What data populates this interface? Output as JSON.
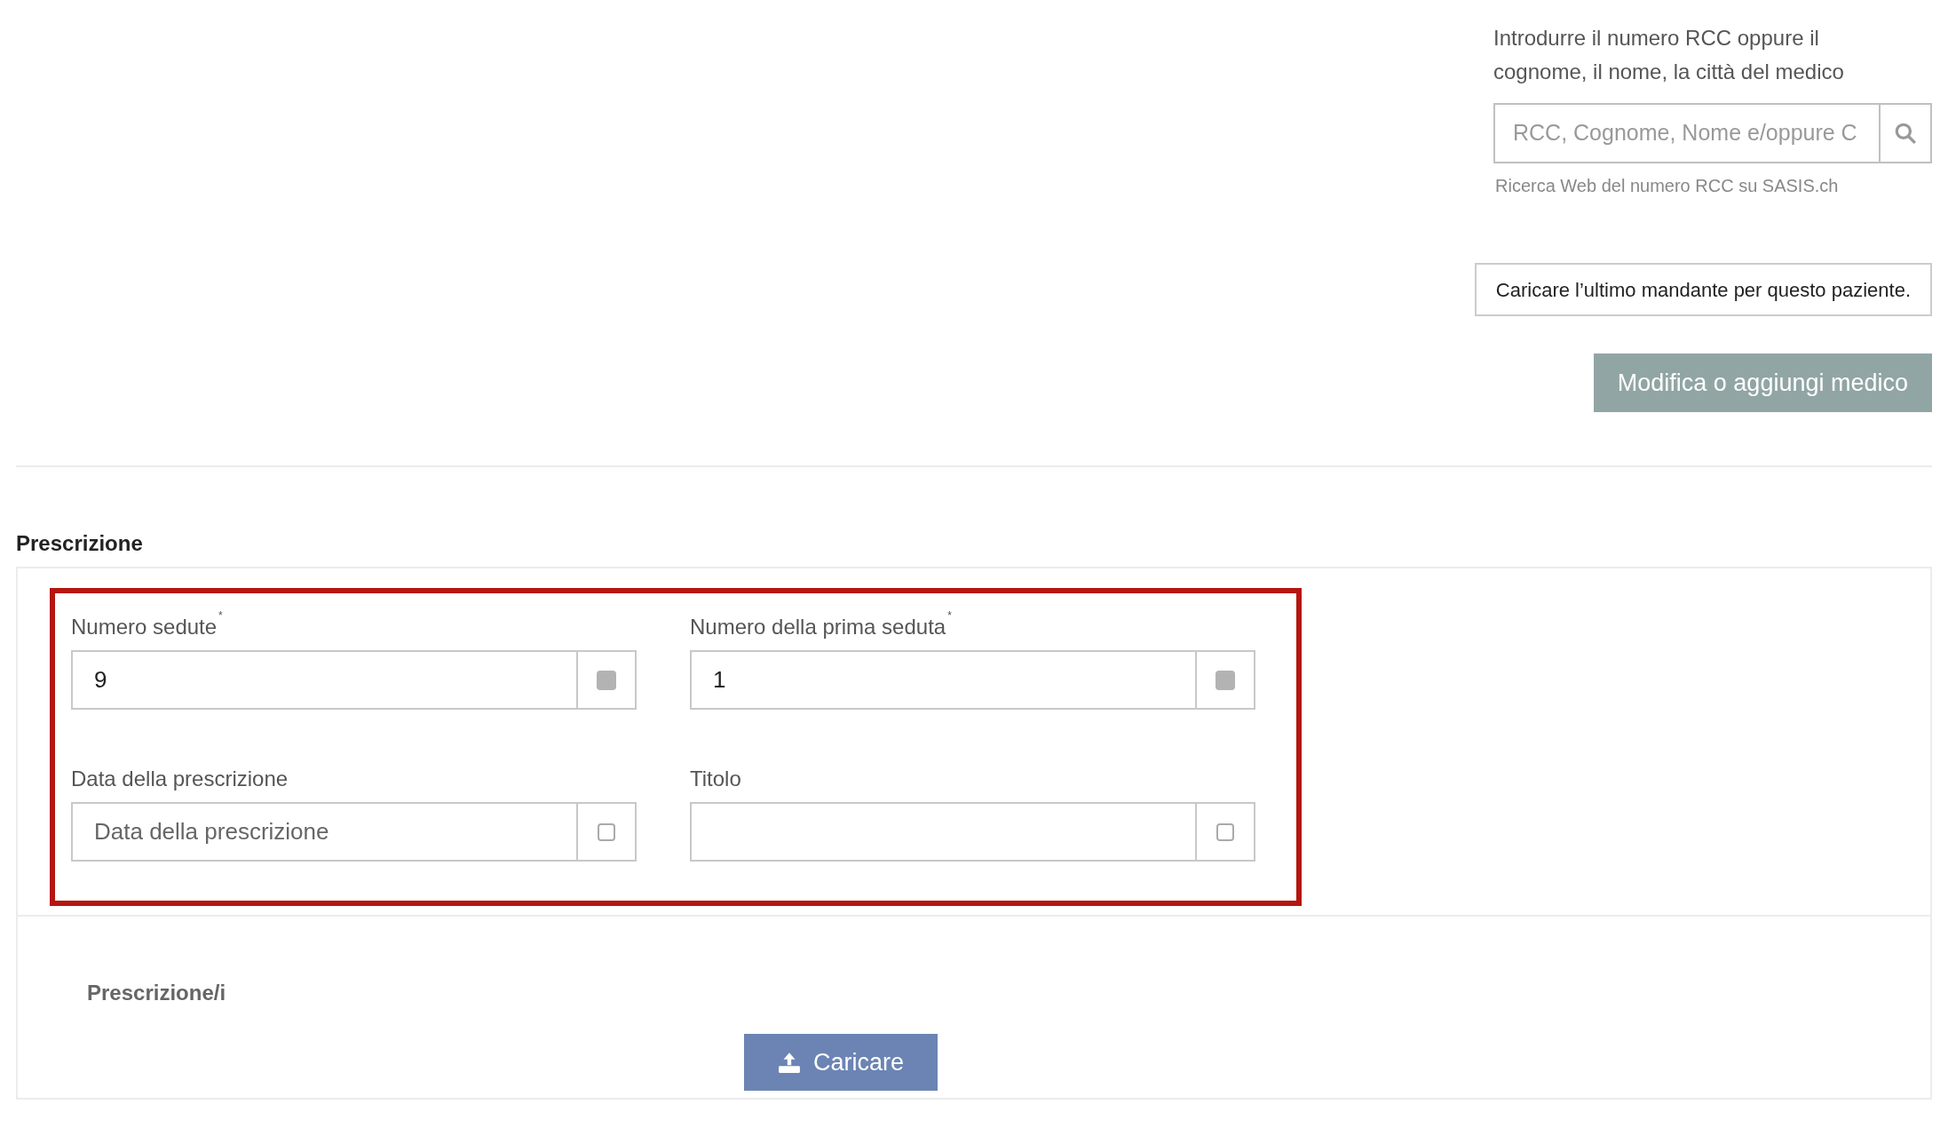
{
  "doctor_search": {
    "hint": "Introdurre il numero RCC oppure il cognome, il nome, la città del medico",
    "placeholder": "RCC, Cognome, Nome e/oppure C",
    "help": "Ricerca Web del numero RCC su SASIS.ch"
  },
  "load_last_button": "Caricare l’ultimo mandante per questo paziente.",
  "edit_doctor_button": "Modifica o aggiungi medico",
  "prescription": {
    "title": "Prescrizione",
    "fields": [
      {
        "label": "Numero sedute",
        "required_mark": "*",
        "value": "9",
        "addon_filled": true
      },
      {
        "label": "Numero della prima seduta",
        "required_mark": "*",
        "value": "1",
        "addon_filled": true
      },
      {
        "label": "Data della prescrizione",
        "placeholder": "Data della prescrizione",
        "addon_filled": false
      },
      {
        "label": "Titolo",
        "addon_filled": false
      }
    ],
    "files_label": "Prescrizione/i",
    "upload_button": "Caricare"
  }
}
